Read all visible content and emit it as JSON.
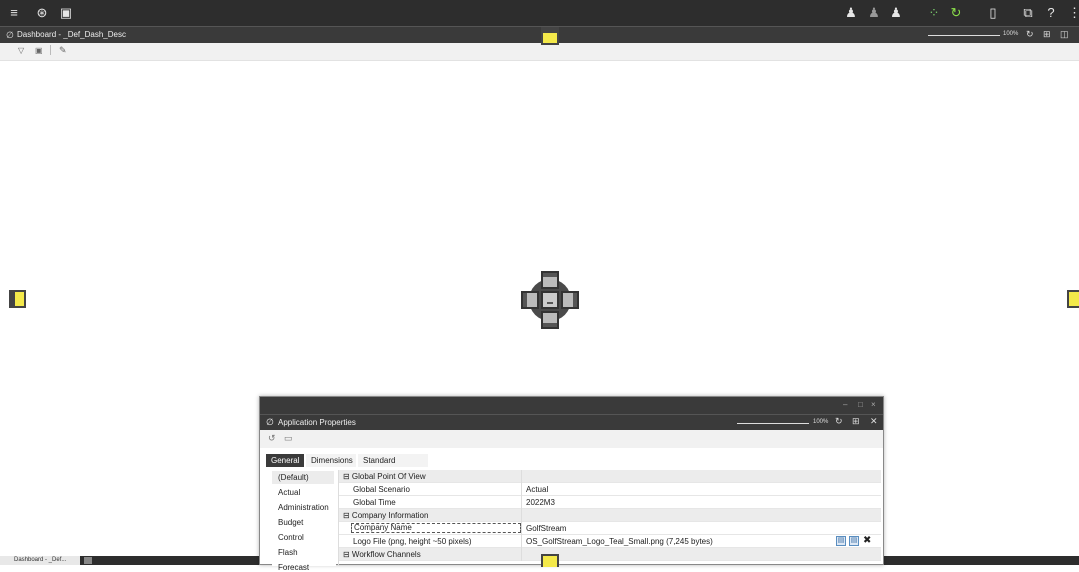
{
  "topbar": {
    "icons": [
      "menu-icon",
      "globe-icon",
      "documents-icon",
      "user-manage-icon",
      "user-icon",
      "user-alert-icon",
      "spinner-icon",
      "refresh-icon",
      "clipboard-icon",
      "window-icon",
      "help-icon"
    ]
  },
  "dashboard": {
    "title": "Dashboard - _Def_Dash_Desc",
    "zoom": "100%"
  },
  "bottom_tab": "Dashboard - _Def...",
  "dialog": {
    "title": "Application Properties",
    "zoom": "100%",
    "tabs": [
      "General",
      "Dimensions",
      "Standard Reports"
    ],
    "left_items": [
      "(Default)",
      "Actual",
      "Administration",
      "Budget",
      "Control",
      "Flash",
      "Forecast"
    ],
    "rows": [
      {
        "type": "cat",
        "label": "⊟ Global Point Of View",
        "value": ""
      },
      {
        "type": "prop",
        "label": "Global Scenario",
        "value": "Actual"
      },
      {
        "type": "prop",
        "label": "Global Time",
        "value": "2022M3"
      },
      {
        "type": "cat",
        "label": "⊟ Company Information",
        "value": ""
      },
      {
        "type": "prop",
        "label": "Company Name",
        "value": "GolfStream"
      },
      {
        "type": "prop",
        "label": "Logo File (png, height ~50 pixels)",
        "value": "OS_GolfStream_Logo_Teal_Small.png (7,245 bytes)"
      },
      {
        "type": "cat",
        "label": "⊟ Workflow Channels",
        "value": ""
      }
    ]
  }
}
